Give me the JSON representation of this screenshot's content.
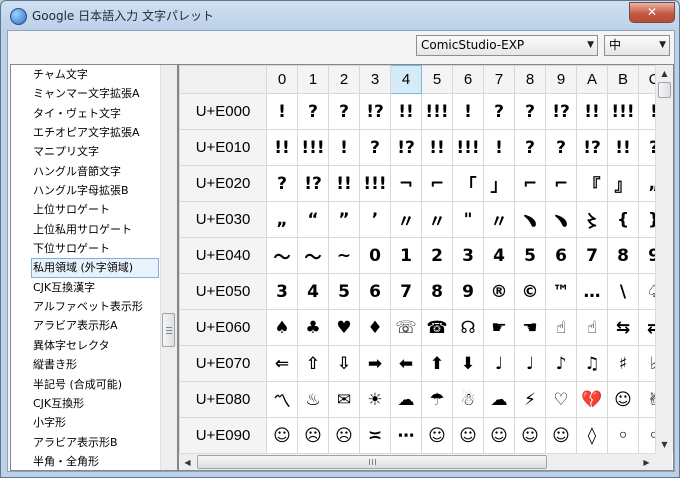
{
  "window": {
    "title": "Google 日本語入力 文字パレット",
    "close_label": "✕"
  },
  "font_select": {
    "value": "ComicStudio-EXP"
  },
  "size_select": {
    "value": "中"
  },
  "sidebar": {
    "items": [
      "チャム文字",
      "ミャンマー文字拡張A",
      "タイ・ヴェト文字",
      "エチオピア文字拡張A",
      "マニプリ文字",
      "ハングル音節文字",
      "ハングル字母拡張B",
      "上位サロゲート",
      "上位私用サロゲート",
      "下位サロゲート",
      "私用領域 (外字領域)",
      "CJK互換漢字",
      "アルファベット表示形",
      "アラビア表示形A",
      "異体字セレクタ",
      "縦書き形",
      "半記号 (合成可能)",
      "CJK互換形",
      "小字形",
      "アラビア表示形B",
      "半角・全角形"
    ],
    "selected_index": 10
  },
  "grid": {
    "columns": [
      "0",
      "1",
      "2",
      "3",
      "4",
      "5",
      "6",
      "7",
      "8",
      "9",
      "A",
      "B",
      "C"
    ],
    "active_column": "4",
    "rows": [
      {
        "label": "U+E000",
        "cells": [
          "!",
          "?",
          "?",
          "!?",
          "!!",
          "!!!",
          "!",
          "?",
          "?",
          "!?",
          "!!",
          "!!!",
          "!"
        ]
      },
      {
        "label": "U+E010",
        "cells": [
          "!!",
          "!!!",
          "!",
          "?",
          "!?",
          "!!",
          "!!!",
          "!",
          "?",
          "?",
          "!?",
          "!!",
          "?"
        ]
      },
      {
        "label": "U+E020",
        "cells": [
          "?",
          "!?",
          "!!",
          "!!!",
          "¬",
          "⌐",
          "「",
          "」",
          "⌐",
          "⌐",
          "『",
          "』",
          "„"
        ]
      },
      {
        "label": "U+E030",
        "cells": [
          "„",
          "“",
          "”",
          "’",
          "〃",
          "〃",
          "\"",
          "〃",
          "﹅",
          "﹅",
          "〻",
          "{",
          "}"
        ]
      },
      {
        "label": "U+E040",
        "cells": [
          "〜",
          "〜",
          "~",
          "0",
          "1",
          "2",
          "3",
          "4",
          "5",
          "6",
          "7",
          "8",
          "9"
        ]
      },
      {
        "label": "U+E050",
        "cells": [
          "3",
          "4",
          "5",
          "6",
          "7",
          "8",
          "9",
          "®",
          "©",
          "™",
          "…",
          "\\",
          "♤"
        ]
      },
      {
        "label": "U+E060",
        "cells": [
          "♠",
          "♣",
          "♥",
          "♦",
          "☏",
          "☎",
          "☊",
          "☛",
          "☚",
          "☝",
          "☝",
          "⇆",
          "⇄"
        ]
      },
      {
        "label": "U+E070",
        "cells": [
          "⇐",
          "⇧",
          "⇩",
          "➡",
          "⬅",
          "⬆",
          "⬇",
          "♩",
          "♩",
          "♪",
          "♫",
          "♯",
          "♭"
        ]
      },
      {
        "label": "U+E080",
        "cells": [
          "〽",
          "♨",
          "✉",
          "☀",
          "☁",
          "☂",
          "☃",
          "☁",
          "⚡",
          "♡",
          "💔",
          "☺",
          "✌"
        ]
      },
      {
        "label": "U+E090",
        "cells": [
          "☺",
          "☹",
          "☹",
          "≍",
          "⋯",
          "☺",
          "☺",
          "☺",
          "☺",
          "☺",
          "◊",
          "◦",
          "◦"
        ]
      }
    ]
  }
}
